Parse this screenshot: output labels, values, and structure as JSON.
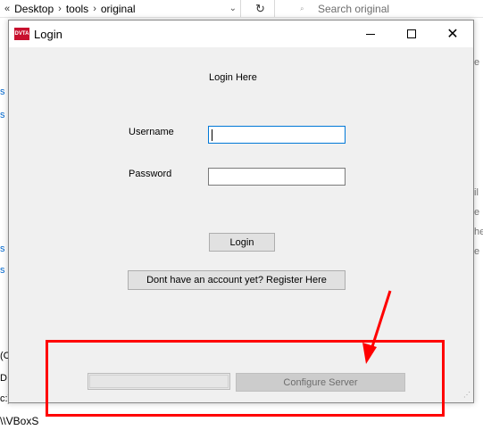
{
  "explorer": {
    "back_chevron": "«",
    "breadcrumb": [
      "Desktop",
      "tools",
      "original"
    ],
    "separator": "›",
    "dropdown_glyph": "⌄",
    "refresh_glyph": "↻",
    "search_placeholder": "Search original",
    "left_fragments": [
      "s",
      "s",
      "s",
      "s",
      "(C",
      "D:",
      "c:)"
    ],
    "right_fragments": [
      "e",
      "il",
      "e",
      "he",
      "e"
    ],
    "bottom_path": "\\\\VBoxS"
  },
  "window": {
    "title": "Login",
    "icon_text": "DVTA",
    "heading": "Login Here",
    "username_label": "Username",
    "password_label": "Password",
    "username_value": "",
    "password_value": "",
    "login_button": "Login",
    "register_button": "Dont have an account yet? Register Here",
    "configure_button": "Configure Server",
    "progress": 0,
    "close_glyph": "✕"
  },
  "annotation": {
    "color": "#ff0000"
  }
}
